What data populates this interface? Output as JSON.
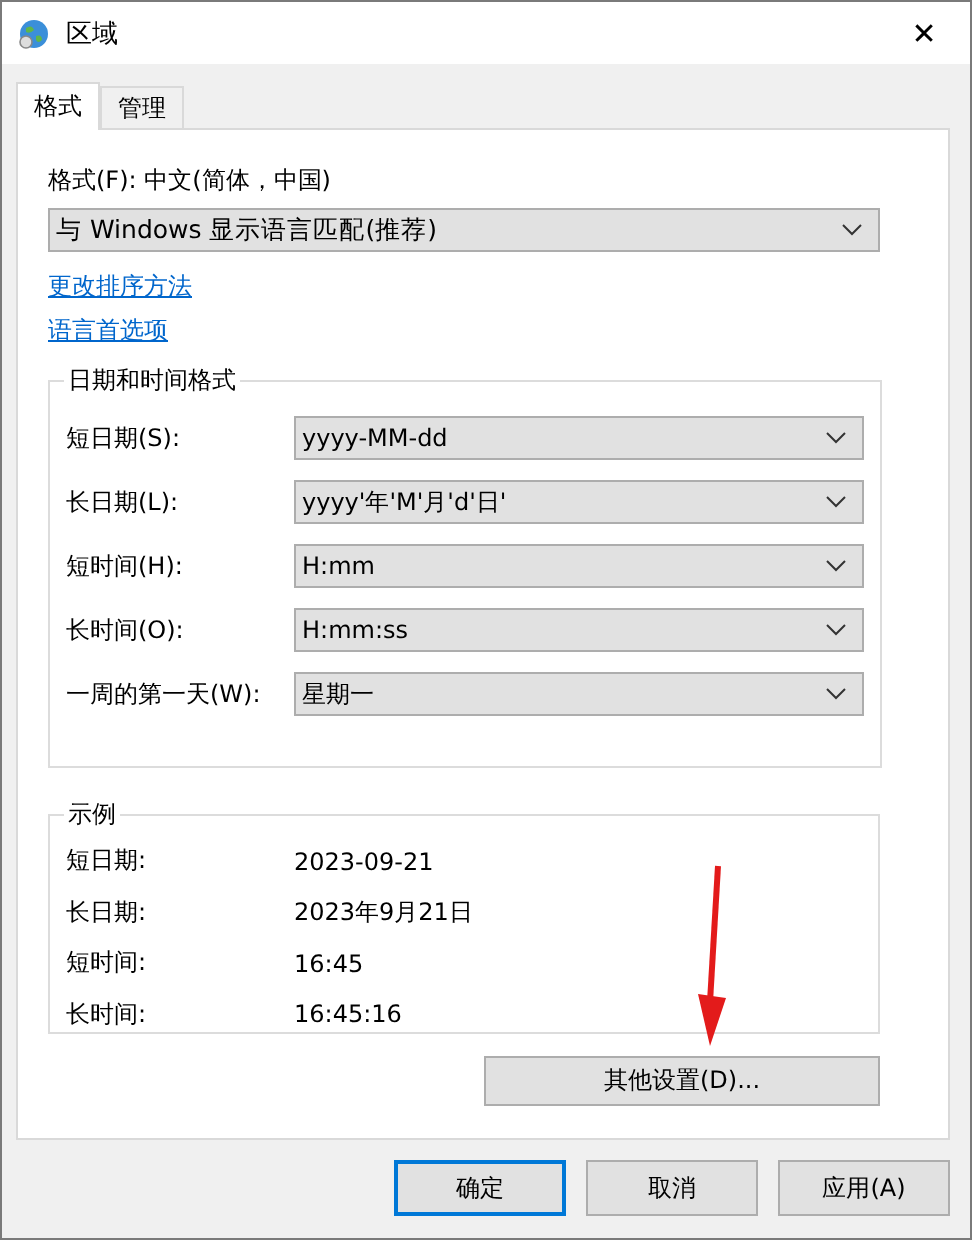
{
  "window": {
    "title": "区域",
    "close": "✕"
  },
  "tabs": [
    {
      "label": "格式",
      "selected": true
    },
    {
      "label": "管理",
      "selected": false
    }
  ],
  "format": {
    "label": "格式(F): 中文(简体，中国)",
    "value": "与 Windows 显示语言匹配(推荐)"
  },
  "links": [
    "更改排序方法",
    "语言首选项"
  ],
  "date_time_formats": {
    "title": "日期和时间格式",
    "rows": [
      {
        "label": "短日期(S):",
        "value": "yyyy-MM-dd"
      },
      {
        "label": "长日期(L):",
        "value": "yyyy'年'M'月'd'日'"
      },
      {
        "label": "短时间(H):",
        "value": "H:mm"
      },
      {
        "label": "长时间(O):",
        "value": "H:mm:ss"
      },
      {
        "label": "一周的第一天(W):",
        "value": "星期一"
      }
    ]
  },
  "examples": {
    "title": "示例",
    "rows": [
      {
        "label": "短日期:",
        "value": "2023-09-21"
      },
      {
        "label": "长日期:",
        "value": "2023年9月21日"
      },
      {
        "label": "短时间:",
        "value": "16:45"
      },
      {
        "label": "长时间:",
        "value": "16:45:16"
      }
    ]
  },
  "more_settings_button": "其他设置(D)...",
  "buttons": [
    {
      "label": "确定",
      "default": true
    },
    {
      "label": "取消",
      "default": false
    },
    {
      "label": "应用(A)",
      "default": false
    }
  ]
}
